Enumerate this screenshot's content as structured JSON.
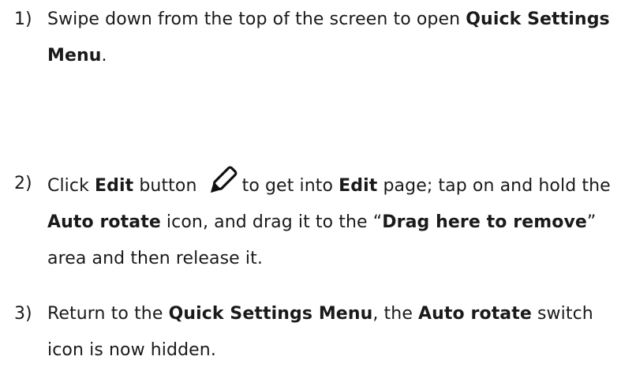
{
  "steps": [
    {
      "number": "1)",
      "segments": [
        {
          "text": "Swipe down from the top of the screen to open ",
          "bold": false
        },
        {
          "text": "Quick Settings Menu",
          "bold": true
        },
        {
          "text": ".",
          "bold": false
        }
      ]
    },
    {
      "number": "2)",
      "segments": [
        {
          "text": "Click ",
          "bold": false
        },
        {
          "text": "Edit",
          "bold": true
        },
        {
          "text": " button ",
          "bold": false
        },
        {
          "text": "to get into ",
          "bold": false
        },
        {
          "text": "Edit",
          "bold": true
        },
        {
          "text": " page; tap on and hold the ",
          "bold": false
        },
        {
          "text": "Auto rotate",
          "bold": true
        },
        {
          "text": " icon, and drag it to the “",
          "bold": false
        },
        {
          "text": "Drag here to remove",
          "bold": true
        },
        {
          "text": "” area and then release it.",
          "bold": false
        }
      ],
      "icon": "pencil-edit-icon"
    },
    {
      "number": "3)",
      "segments": [
        {
          "text": "Return to the ",
          "bold": false
        },
        {
          "text": "Quick Settings Menu",
          "bold": true
        },
        {
          "text": ", the ",
          "bold": false
        },
        {
          "text": "Auto rotate",
          "bold": true
        },
        {
          "text": " switch icon is now hidden.",
          "bold": false
        }
      ]
    }
  ]
}
